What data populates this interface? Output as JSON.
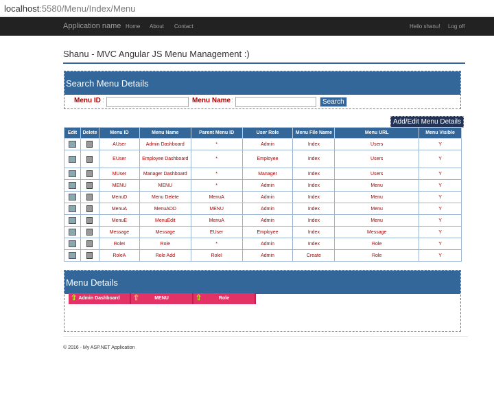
{
  "browser": {
    "host": "localhost",
    "path": ":5580/Menu/Index/Menu"
  },
  "nav": {
    "brand": "Application name",
    "links": [
      "Home",
      "About",
      "Contact"
    ],
    "user": "Hello shanu!",
    "logoff": "Log off"
  },
  "title": "Shanu - MVC Angular JS Menu Management :)",
  "search": {
    "heading": "Search Menu Details",
    "menu_id_label": "Menu ID",
    "menu_name_label": "Menu Name",
    "colon": ":",
    "menu_id_value": "",
    "menu_name_value": "",
    "button": "Search"
  },
  "add_button": "Add/Edit Menu Details",
  "table": {
    "headers": [
      "Edit",
      "Delete",
      "Menu ID",
      "Menu Name",
      "Parent Menu ID",
      "User Role",
      "Menu File Name",
      "Menu URL",
      "Menu Visible"
    ],
    "rows": [
      [
        "AUser",
        "Admin Dashboard",
        "*",
        "Admin",
        "Index",
        "Users",
        "Y"
      ],
      [
        "EUser",
        "Employee Dashboard",
        "*",
        "Employee",
        "Index",
        "Users",
        "Y"
      ],
      [
        "MUser",
        "Manager Dashboard",
        "*",
        "Manager",
        "Index",
        "Users",
        "Y"
      ],
      [
        "MENU",
        "MENU",
        "*",
        "Admin",
        "Index",
        "Menu",
        "Y"
      ],
      [
        "MenuD",
        "Menu Delete",
        "MenuA",
        "Admin",
        "Index",
        "Menu",
        "Y"
      ],
      [
        "MenuA",
        "MenuADD",
        "MENU",
        "Admin",
        "Index",
        "Menu",
        "Y"
      ],
      [
        "MenuE",
        "MenuEdit",
        "MenuA",
        "Admin",
        "Index",
        "Menu",
        "Y"
      ],
      [
        "Message",
        "Message",
        "EUser",
        "Employee",
        "Index",
        "Message",
        "Y"
      ],
      [
        "RoleI",
        "Role",
        "*",
        "Admin",
        "Index",
        "Role",
        "Y"
      ],
      [
        "RoleA",
        "Role Add",
        "RoleI",
        "Admin",
        "Create",
        "Role",
        "Y"
      ]
    ]
  },
  "menu_details": {
    "heading": "Menu Details",
    "items": [
      "Admin Dashboard",
      "MENU",
      "Role"
    ]
  },
  "footer": "© 2016 - My ASP.NET Application"
}
